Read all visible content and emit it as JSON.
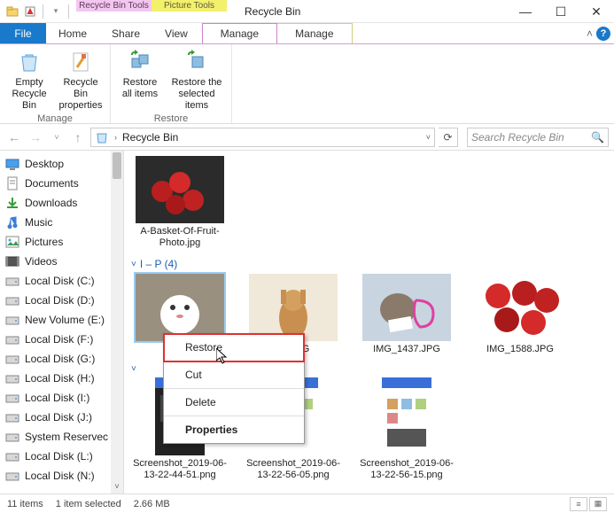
{
  "title": "Recycle Bin",
  "contextual_tabs": [
    {
      "header": "Recycle Bin Tools",
      "label": "Manage"
    },
    {
      "header": "Picture Tools",
      "label": "Manage"
    }
  ],
  "tabs": {
    "file": "File",
    "home": "Home",
    "share": "Share",
    "view": "View"
  },
  "ribbon": {
    "groups": [
      {
        "label": "Manage",
        "buttons": [
          {
            "name": "empty-recycle-bin",
            "label": "Empty\nRecycle Bin"
          },
          {
            "name": "recycle-bin-properties",
            "label": "Recycle Bin\nproperties"
          }
        ]
      },
      {
        "label": "Restore",
        "buttons": [
          {
            "name": "restore-all-items",
            "label": "Restore\nall items"
          },
          {
            "name": "restore-selected-items",
            "label": "Restore the\nselected items"
          }
        ]
      }
    ]
  },
  "address": {
    "location": "Recycle Bin"
  },
  "search": {
    "placeholder": "Search Recycle Bin"
  },
  "sidebar": {
    "items": [
      {
        "icon": "desktop",
        "label": "Desktop"
      },
      {
        "icon": "document",
        "label": "Documents"
      },
      {
        "icon": "download",
        "label": "Downloads"
      },
      {
        "icon": "music",
        "label": "Music"
      },
      {
        "icon": "picture",
        "label": "Pictures"
      },
      {
        "icon": "video",
        "label": "Videos"
      },
      {
        "icon": "disk",
        "label": "Local Disk (C:)"
      },
      {
        "icon": "disk",
        "label": "Local Disk (D:)"
      },
      {
        "icon": "disk",
        "label": "New Volume (E:)"
      },
      {
        "icon": "disk",
        "label": "Local Disk (F:)"
      },
      {
        "icon": "disk",
        "label": "Local Disk (G:)"
      },
      {
        "icon": "disk",
        "label": "Local Disk (H:)"
      },
      {
        "icon": "disk",
        "label": "Local Disk (I:)"
      },
      {
        "icon": "disk",
        "label": "Local Disk (J:)"
      },
      {
        "icon": "disk",
        "label": "System Reservec"
      },
      {
        "icon": "disk",
        "label": "Local Disk (L:)"
      },
      {
        "icon": "disk",
        "label": "Local Disk (N:)"
      }
    ]
  },
  "groups": [
    {
      "header": "",
      "items": [
        {
          "name": "A-Basket-Of-Fruit-Photo.jpg",
          "thumb": "strawberries"
        }
      ]
    },
    {
      "header": "I – P (4)",
      "items": [
        {
          "name": "",
          "thumb": "white-cat",
          "selected": true
        },
        {
          "name": "02.JPG",
          "thumb": "cat-paws-up"
        },
        {
          "name": "IMG_1437.JPG",
          "thumb": "cat-heart"
        },
        {
          "name": "IMG_1588.JPG",
          "thumb": "strawberries2"
        }
      ]
    },
    {
      "header": "",
      "items": [
        {
          "name": "Screenshot_2019-06-13-22-44-51.png",
          "thumb": "phone1"
        },
        {
          "name": "Screenshot_2019-06-13-22-56-05.png",
          "thumb": "phone2"
        },
        {
          "name": "Screenshot_2019-06-13-22-56-15.png",
          "thumb": "phone3"
        }
      ]
    }
  ],
  "context_menu": {
    "items": [
      {
        "label": "Restore",
        "highlight": true
      },
      {
        "label": "Cut"
      },
      {
        "label": "Delete"
      },
      {
        "label": "Properties",
        "bold": true
      }
    ]
  },
  "status": {
    "count": "11 items",
    "selection": "1 item selected",
    "size": "2.66 MB"
  }
}
